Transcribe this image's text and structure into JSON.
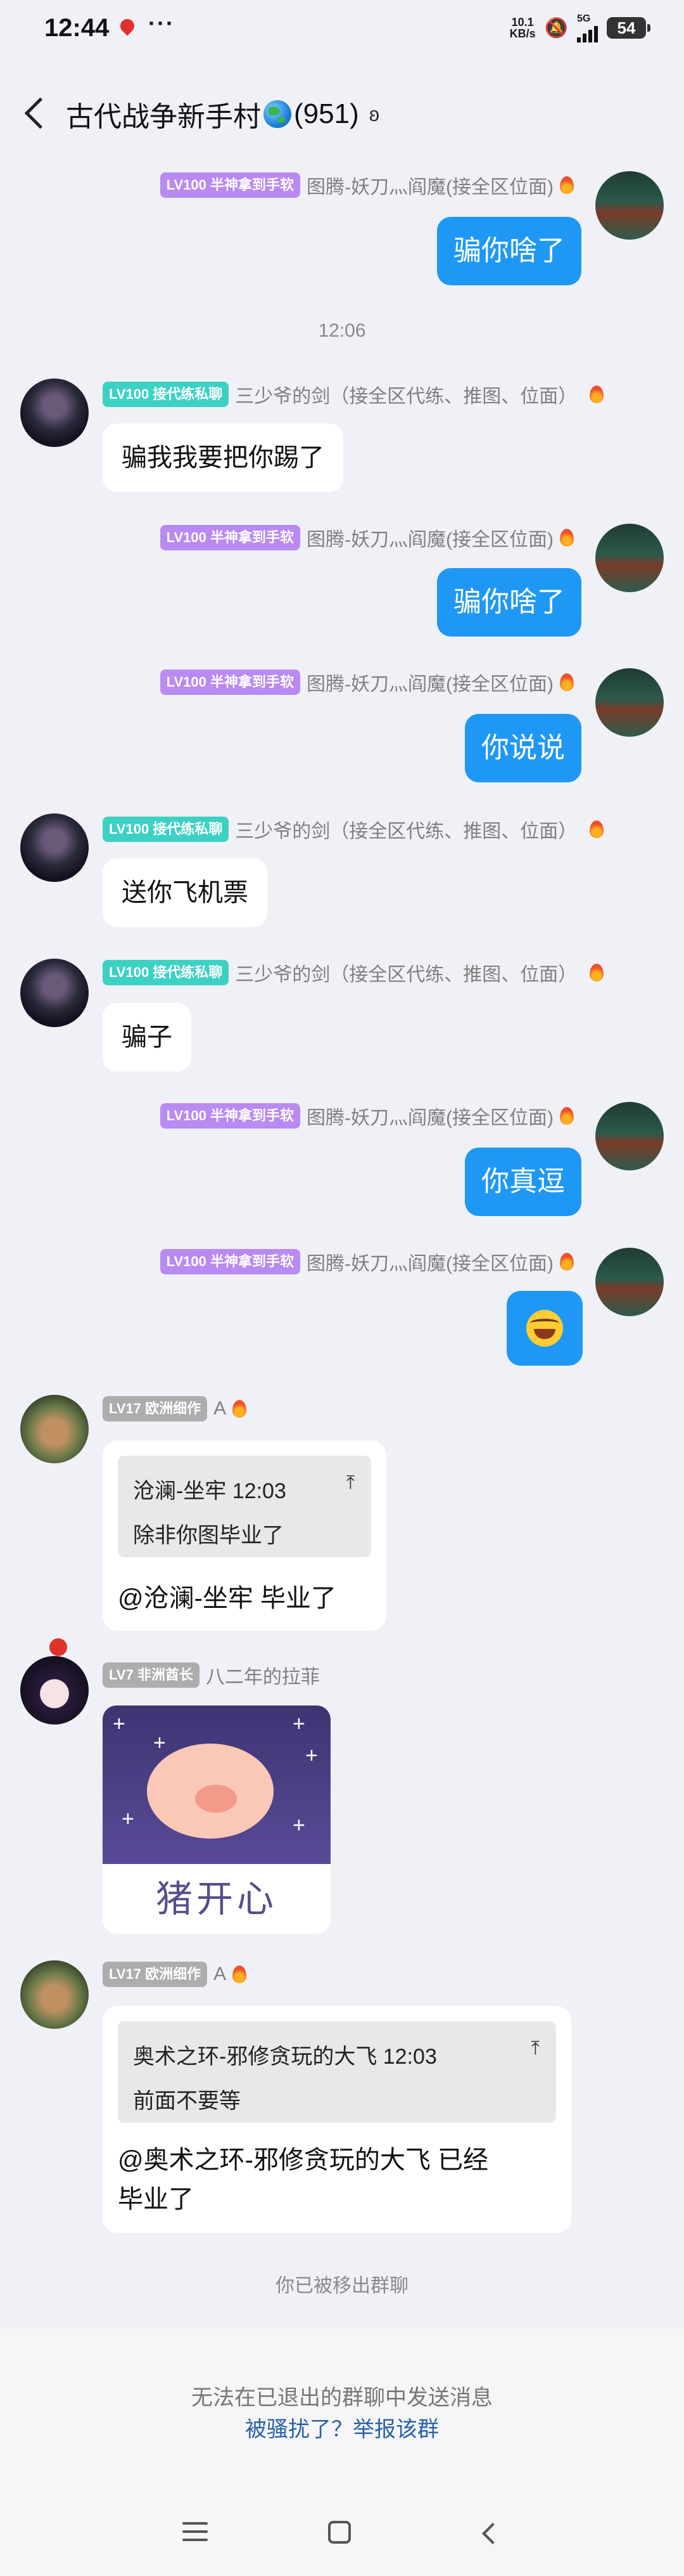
{
  "status": {
    "time": "12:44",
    "net_speed_value": "10.1",
    "net_speed_unit": "KB/s",
    "signal": "5G",
    "battery": "54"
  },
  "header": {
    "title": "古代战争新手村",
    "count": "(951)"
  },
  "time_divider": "12:06",
  "messages": [
    {
      "badge": "LV100 半神拿到手软",
      "name": "图腾-妖刀灬阎魔(接全区位面)",
      "text": "骗你啥了"
    },
    {
      "badge": "LV100 接代练私聊",
      "name": "三少爷的剑（接全区代练、推图、位面）",
      "text": "骗我我要把你踢了"
    },
    {
      "badge": "LV100 半神拿到手软",
      "name": "图腾-妖刀灬阎魔(接全区位面)",
      "text": "骗你啥了"
    },
    {
      "badge": "LV100 半神拿到手软",
      "name": "图腾-妖刀灬阎魔(接全区位面)",
      "text": "你说说"
    },
    {
      "badge": "LV100 接代练私聊",
      "name": "三少爷的剑（接全区代练、推图、位面）",
      "text": "送你飞机票"
    },
    {
      "badge": "LV100 接代练私聊",
      "name": "三少爷的剑（接全区代练、推图、位面）",
      "text": "骗子"
    },
    {
      "badge": "LV100 半神拿到手软",
      "name": "图腾-妖刀灬阎魔(接全区位面)",
      "text": "你真逗"
    },
    {
      "badge": "LV100 半神拿到手软",
      "name": "图腾-妖刀灬阎魔(接全区位面)",
      "emoji": "laughing-tears"
    },
    {
      "badge": "LV17 欧洲细作",
      "name": "A",
      "quote_head": "沧澜-坐牢 12:03",
      "quote_body": "除非你图毕业了",
      "text": "@沧澜-坐牢 毕业了"
    },
    {
      "badge": "LV7 非洲酋长",
      "name": "八二年的拉菲",
      "sticker_text": "猪开心"
    },
    {
      "badge": "LV17 欧洲细作",
      "name": "A",
      "quote_head": "奥术之环-邪修贪玩的大飞 12:03",
      "quote_body": "前面不要等",
      "text_line1": "@奥术之环-邪修贪玩的大飞 已经",
      "text_line2": "毕业了"
    }
  ],
  "removed_note": "你已被移出群聊",
  "footer": {
    "cannot_send": "无法在已退出的群聊中发送消息",
    "report_link": "被骚扰了？举报该群"
  },
  "colors": {
    "self_bubble": "#1f98f5",
    "badge_purple": "#b98af2",
    "badge_teal": "#3dd1c3",
    "badge_gray": "#adadad",
    "link": "#2860a8"
  }
}
